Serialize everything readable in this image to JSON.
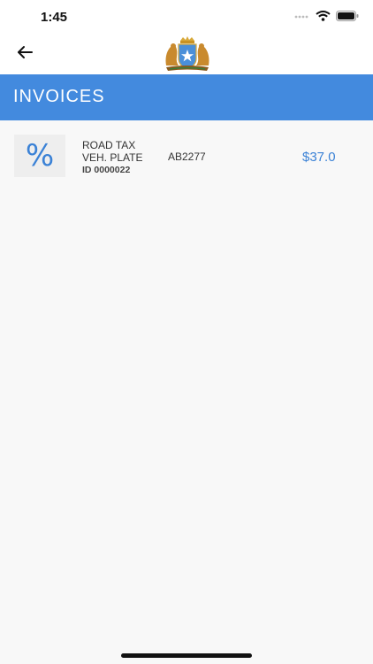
{
  "status_bar": {
    "time": "1:45",
    "icons": [
      "signal-icon",
      "wifi-icon",
      "battery-icon"
    ]
  },
  "nav": {
    "back_icon": "arrow-left-icon",
    "emblem": "coat-of-arms-emblem"
  },
  "header": {
    "title": "INVOICES",
    "background_color": "#438ade"
  },
  "invoices": [
    {
      "icon": "percent-icon",
      "type": "ROAD TAX",
      "category": "VEH. PLATE",
      "id_label": "ID 0000022",
      "plate": "AB2277",
      "amount": "$37.0",
      "amount_color": "#3b82d6"
    }
  ]
}
